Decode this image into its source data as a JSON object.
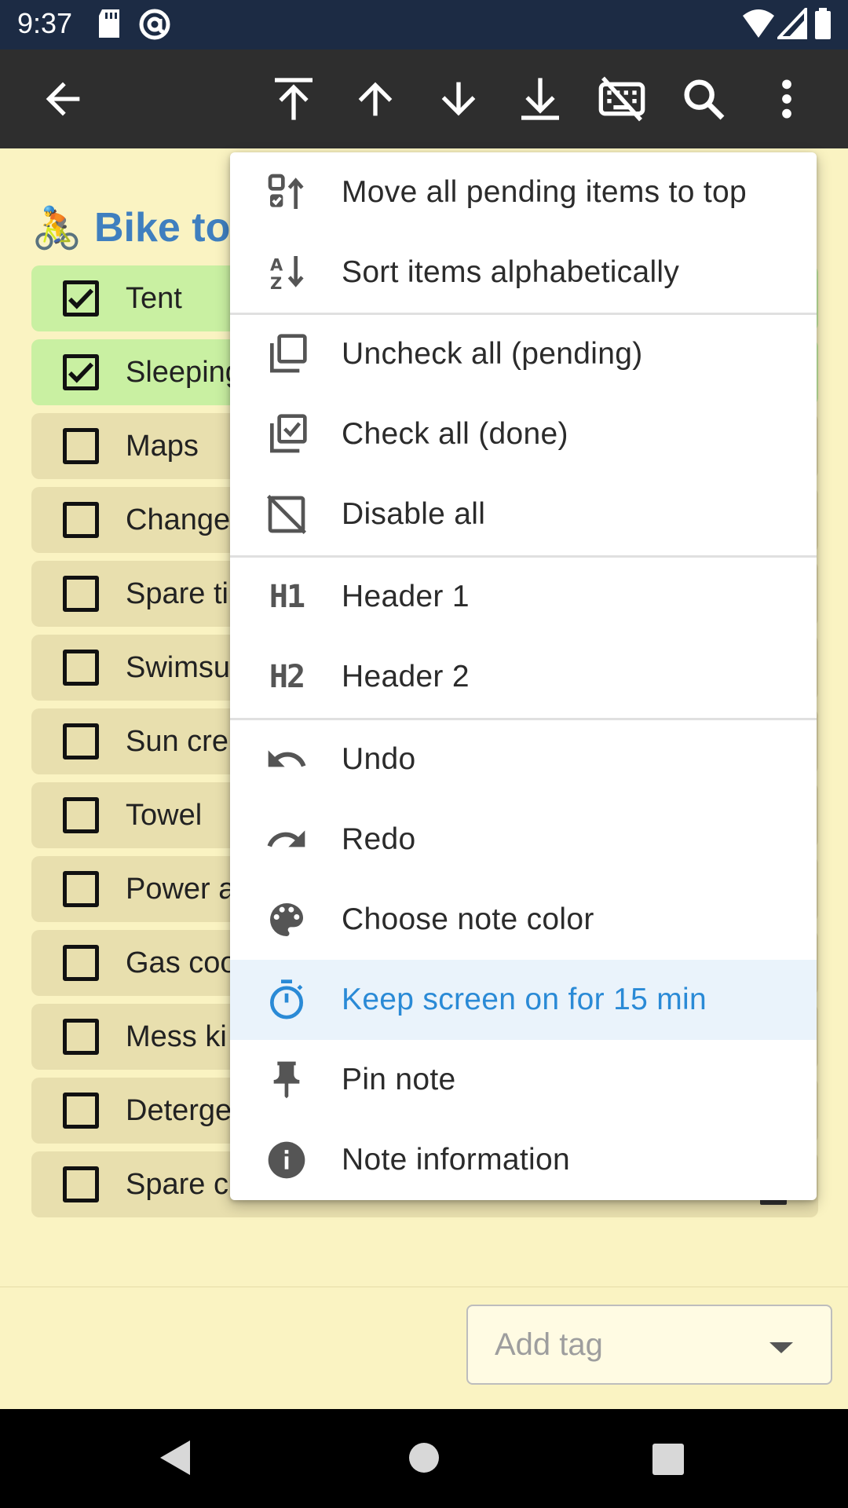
{
  "status_bar": {
    "time": "9:37"
  },
  "toolbar": {
    "icons": [
      "back-arrow-icon",
      "move-to-top-icon",
      "move-up-icon",
      "move-down-icon",
      "move-to-bottom-icon",
      "hide-keyboard-icon",
      "search-icon",
      "more-vert-icon"
    ]
  },
  "note": {
    "emoji": "🚴",
    "title": "Bike tou",
    "items": [
      {
        "label": "Tent",
        "checked": true
      },
      {
        "label": "Sleeping",
        "checked": true
      },
      {
        "label": "Maps",
        "checked": false
      },
      {
        "label": "Change",
        "checked": false
      },
      {
        "label": "Spare ti",
        "checked": false
      },
      {
        "label": "Swimsu",
        "checked": false
      },
      {
        "label": "Sun cre",
        "checked": false
      },
      {
        "label": "Towel",
        "checked": false
      },
      {
        "label": "Power a",
        "checked": false
      },
      {
        "label": "Gas coo",
        "checked": false
      },
      {
        "label": "Mess ki",
        "checked": false
      },
      {
        "label": "Deterge",
        "checked": false
      },
      {
        "label": "Spare c",
        "checked": false
      }
    ]
  },
  "tag_input": {
    "placeholder": "Add tag"
  },
  "menu": {
    "items": [
      {
        "label": "Move all pending items to top",
        "icon": "move-pending-top-icon"
      },
      {
        "label": "Sort items alphabetically",
        "icon": "sort-alpha-icon"
      },
      {
        "label": "Uncheck all (pending)",
        "icon": "uncheck-all-icon"
      },
      {
        "label": "Check all (done)",
        "icon": "check-all-icon"
      },
      {
        "label": "Disable all",
        "icon": "disable-all-icon"
      },
      {
        "label": "Header 1",
        "icon": "h1-icon",
        "glyph": "H1"
      },
      {
        "label": "Header 2",
        "icon": "h2-icon",
        "glyph": "H2"
      },
      {
        "label": "Undo",
        "icon": "undo-icon"
      },
      {
        "label": "Redo",
        "icon": "redo-icon"
      },
      {
        "label": "Choose note color",
        "icon": "palette-icon"
      },
      {
        "label": "Keep screen on for 15 min",
        "icon": "timer-icon",
        "highlighted": true
      },
      {
        "label": "Pin note",
        "icon": "pin-icon"
      },
      {
        "label": "Note information",
        "icon": "info-icon"
      }
    ]
  },
  "colors": {
    "toolbar": "#2e2e2e",
    "status_bar": "#1c2b44",
    "note_background": "#faf3c2",
    "checked_item": "#c9f0a2",
    "unchecked_item": "#e8dfae",
    "title_accent": "#3f7fbf",
    "menu_highlight": "#2a8ad6"
  }
}
